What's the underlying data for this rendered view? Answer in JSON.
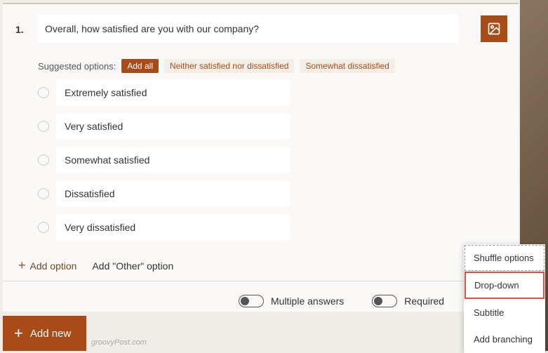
{
  "question": {
    "number": "1.",
    "text": "Overall, how satisfied are you with our company?"
  },
  "suggested": {
    "label": "Suggested options:",
    "add_all": "Add all",
    "chips": [
      "Neither satisfied nor dissatisfied",
      "Somewhat dissatisfied"
    ]
  },
  "options": [
    "Extremely satisfied",
    "Very satisfied",
    "Somewhat satisfied",
    "Dissatisfied",
    "Very dissatisfied"
  ],
  "footer": {
    "add_option": "Add option",
    "add_other": "Add \"Other\" option",
    "multiple": "Multiple answers",
    "required": "Required"
  },
  "add_new": "Add new",
  "menu": {
    "shuffle": "Shuffle options",
    "dropdown": "Drop-down",
    "subtitle": "Subtitle",
    "branching": "Add branching"
  },
  "watermark": "groovyPost.com"
}
